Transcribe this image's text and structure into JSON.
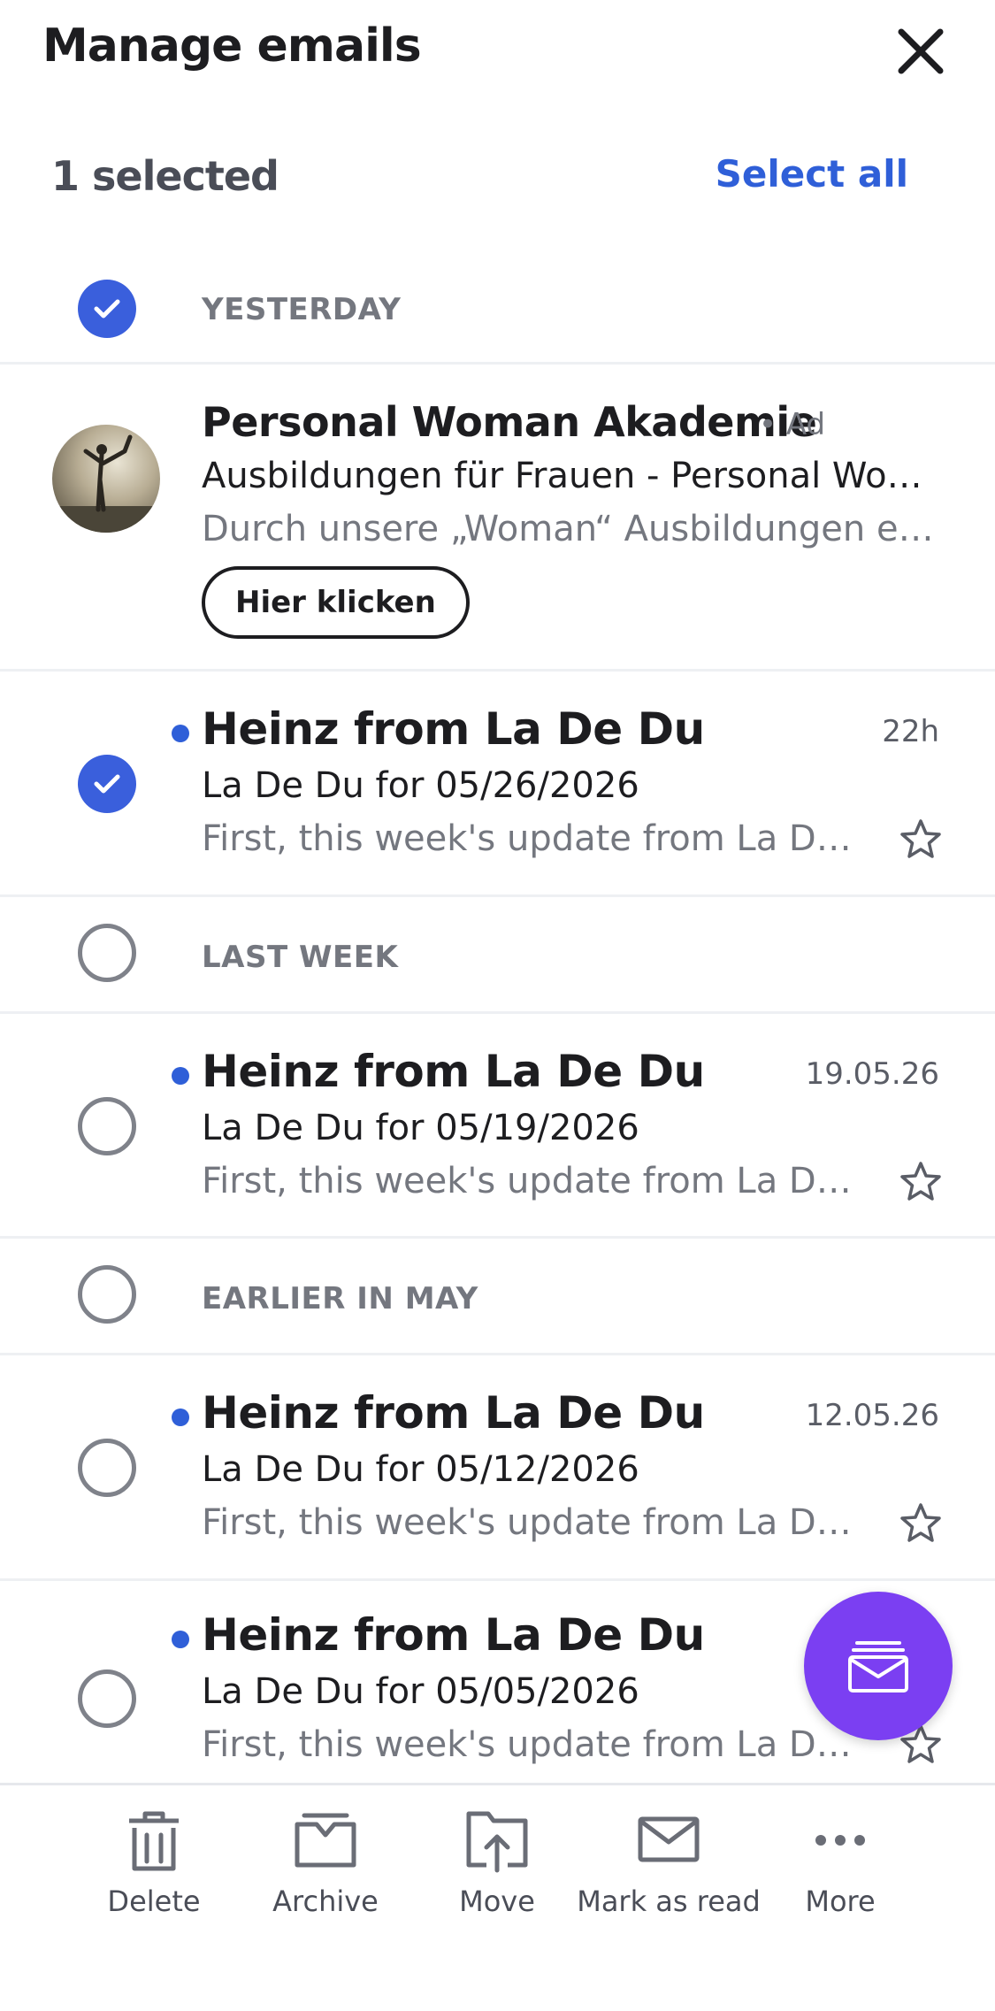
{
  "header": {
    "title": "Manage emails"
  },
  "selection": {
    "count_text": "1 selected",
    "select_all": "Select all"
  },
  "sections": {
    "yesterday": "YESTERDAY",
    "last_week": "LAST WEEK",
    "earlier": "EARLIER IN MAY"
  },
  "ad": {
    "title": "Personal Woman Akademie",
    "badge": "• Ad",
    "subject": "Ausbildungen für Frauen - Personal Woman Akademie",
    "preview": "Durch unsere „Woman“ Ausbildungen erlangen Sie",
    "cta": "Hier klicken"
  },
  "emails": [
    {
      "sender": "Heinz from La De Du",
      "time": "22h",
      "subject": "La De Du for 05/26/2026",
      "preview": "First, this week's update from La De Du",
      "selected": true
    },
    {
      "sender": "Heinz from La De Du",
      "time": "19.05.26",
      "subject": "La De Du for 05/19/2026",
      "preview": "First, this week's update from La De Du",
      "selected": false
    },
    {
      "sender": "Heinz from La De Du",
      "time": "12.05.26",
      "subject": "La De Du for 05/12/2026",
      "preview": "First, this week's update from La De Du",
      "selected": false
    },
    {
      "sender": "Heinz from La De Du",
      "time": "",
      "subject": "La De Du for 05/05/2026",
      "preview": "First, this week's update from La De Du",
      "selected": false
    }
  ],
  "toolbar": {
    "delete": "Delete",
    "archive": "Archive",
    "move": "Move",
    "mark_read": "Mark as read",
    "more": "More"
  },
  "colors": {
    "accent": "#2f5fd8",
    "fab": "#7b3ff2",
    "check": "#3a5fdc"
  },
  "icons": [
    "close-icon",
    "check-icon",
    "star-icon",
    "compose-icon",
    "trash-icon",
    "archive-icon",
    "move-icon",
    "envelope-icon",
    "more-icon"
  ]
}
